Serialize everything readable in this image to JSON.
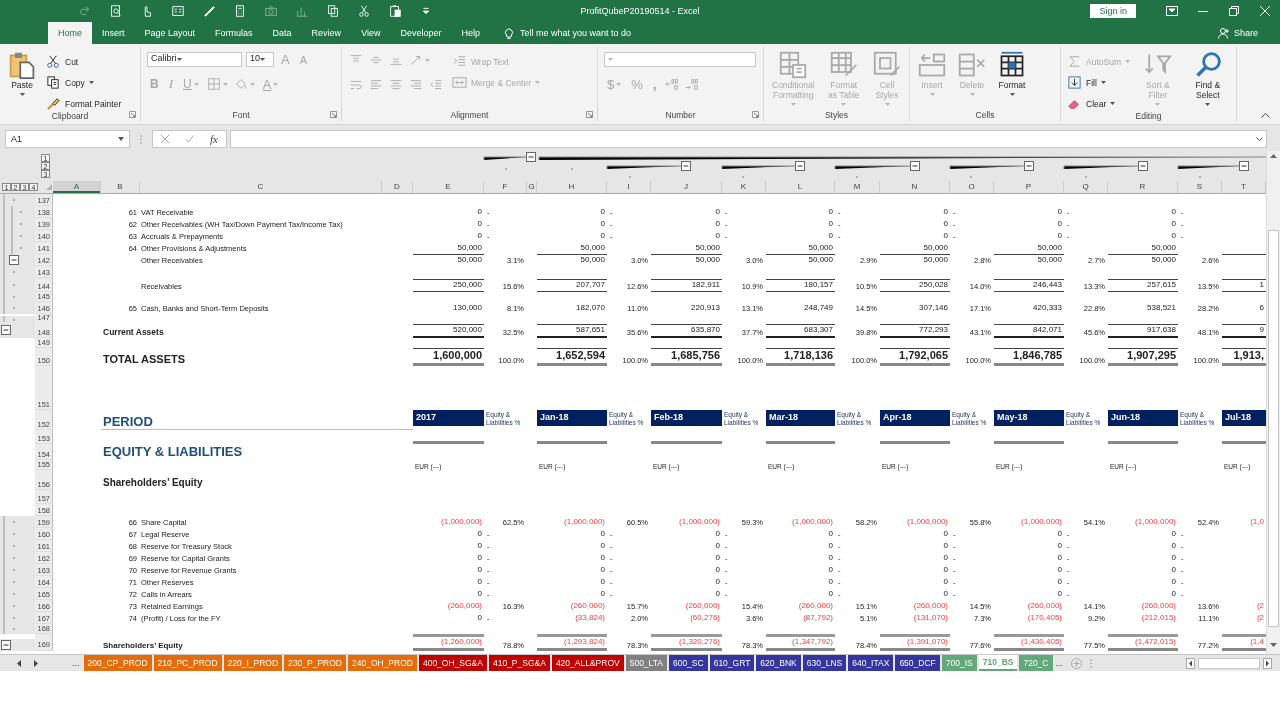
{
  "window": {
    "title": "ProfitQubeP20190514 - Excel",
    "sign_in": "Sign in",
    "share": "Share"
  },
  "quick_access": [
    {
      "disabled": true
    },
    {
      "disabled": false
    },
    {
      "disabled": false
    },
    {
      "disabled": false
    },
    {
      "disabled": false
    },
    {
      "disabled": false
    },
    {
      "disabled": true
    },
    {
      "disabled": true
    },
    {
      "disabled": false
    },
    {
      "disabled": false
    },
    {
      "disabled": false
    },
    {
      "disabled": false
    }
  ],
  "ribbon_tabs": [
    {
      "label": "Home",
      "selected": true
    },
    {
      "label": "Insert",
      "selected": false
    },
    {
      "label": "Page Layout",
      "selected": false
    },
    {
      "label": "Formulas",
      "selected": false
    },
    {
      "label": "Data",
      "selected": false
    },
    {
      "label": "Review",
      "selected": false
    },
    {
      "label": "View",
      "selected": false
    },
    {
      "label": "Developer",
      "selected": false
    },
    {
      "label": "Help",
      "selected": false
    }
  ],
  "tell_me": "Tell me what you want to do",
  "ribbon": {
    "groups": [
      {
        "label": "Clipboard",
        "launcher": true,
        "columns": [
          [
            [
              {
                "kind": "large",
                "label": "Paste",
                "dropdown": true,
                "disabled": false
              }
            ]
          ],
          [
            [
              {
                "kind": "small",
                "label": "Cut",
                "dropdown": false,
                "disabled": false
              }
            ],
            [
              {
                "kind": "small",
                "label": "Copy",
                "dropdown": true,
                "disabled": false
              }
            ],
            [
              {
                "kind": "small",
                "label": "Format Painter",
                "dropdown": false,
                "disabled": false
              }
            ]
          ]
        ]
      },
      {
        "label": "Font",
        "launcher": true,
        "columns": [
          [
            [
              {
                "kind": "field",
                "value": "Calibri",
                "dropdown": true,
                "disabled": false
              },
              {
                "kind": "field",
                "value": "10",
                "dropdown": true,
                "disabled": false
              },
              {
                "kind": "glyph",
                "label": "A",
                "dropdown": false,
                "disabled": true
              },
              {
                "kind": "glyph",
                "label": "A",
                "dropdown": false,
                "disabled": true
              }
            ],
            [
              {
                "kind": "glyph",
                "label": "B",
                "dropdown": false,
                "disabled": true
              },
              {
                "kind": "glyph",
                "label": "I",
                "dropdown": false,
                "disabled": true
              },
              {
                "kind": "glyph",
                "label": "U",
                "dropdown": true,
                "disabled": true
              },
              {
                "kind": "icon",
                "dropdown": true,
                "disabled": true
              },
              {
                "kind": "icon",
                "dropdown": true,
                "disabled": true
              },
              {
                "kind": "glyph",
                "label": "A",
                "dropdown": true,
                "disabled": true
              }
            ]
          ]
        ]
      },
      {
        "label": "Alignment",
        "launcher": true,
        "columns": [
          [
            [
              {
                "kind": "icon",
                "dropdown": false,
                "disabled": true
              },
              {
                "kind": "icon",
                "dropdown": false,
                "disabled": true
              },
              {
                "kind": "icon",
                "dropdown": false,
                "disabled": true
              },
              {
                "kind": "icon",
                "dropdown": true,
                "disabled": true
              }
            ],
            [
              {
                "kind": "icon",
                "dropdown": false,
                "disabled": true
              },
              {
                "kind": "icon",
                "dropdown": false,
                "disabled": true
              },
              {
                "kind": "icon",
                "dropdown": false,
                "disabled": true
              },
              {
                "kind": "icon",
                "dropdown": false,
                "disabled": true
              },
              {
                "kind": "icon",
                "dropdown": false,
                "disabled": true
              }
            ]
          ],
          [
            [
              {
                "kind": "small",
                "label": "Wrap Text",
                "dropdown": false,
                "disabled": true
              }
            ],
            [
              {
                "kind": "small",
                "label": "Merge & Center",
                "dropdown": true,
                "disabled": true
              }
            ]
          ]
        ]
      },
      {
        "label": "Number",
        "launcher": true,
        "columns": [
          [
            [
              {
                "kind": "field",
                "dropdown": true,
                "disabled": true
              }
            ],
            [
              {
                "kind": "glyph",
                "label": "$",
                "dropdown": true,
                "disabled": true
              },
              {
                "kind": "glyph",
                "label": "%",
                "dropdown": false,
                "disabled": true
              },
              {
                "kind": "glyph",
                "label": ",",
                "dropdown": false,
                "disabled": true
              },
              {
                "kind": "icon",
                "dropdown": false,
                "disabled": true
              },
              {
                "kind": "icon",
                "dropdown": false,
                "disabled": true
              }
            ]
          ]
        ]
      },
      {
        "label": "Styles",
        "columns": [
          [
            [
              {
                "kind": "large",
                "label": "Conditional Formatting",
                "dropdown": true,
                "disabled": true
              }
            ]
          ],
          [
            [
              {
                "kind": "large",
                "label": "Format as Table",
                "dropdown": true,
                "disabled": true
              }
            ]
          ],
          [
            [
              {
                "kind": "large",
                "label": "Cell Styles",
                "dropdown": true,
                "disabled": true
              }
            ]
          ]
        ]
      },
      {
        "label": "Cells",
        "columns": [
          [
            [
              {
                "kind": "large",
                "label": "Insert",
                "dropdown": true,
                "disabled": true
              }
            ]
          ],
          [
            [
              {
                "kind": "large",
                "label": "Delete",
                "dropdown": true,
                "disabled": true
              }
            ]
          ],
          [
            [
              {
                "kind": "large",
                "label": "Format",
                "dropdown": true,
                "disabled": false
              }
            ]
          ]
        ]
      },
      {
        "label": "Editing",
        "columns": [
          [
            [
              {
                "kind": "small",
                "label": "AutoSum",
                "dropdown": true,
                "disabled": true
              }
            ],
            [
              {
                "kind": "small",
                "label": "Fill",
                "dropdown": true,
                "disabled": false
              }
            ],
            [
              {
                "kind": "small",
                "label": "Clear",
                "dropdown": true,
                "disabled": false
              }
            ]
          ],
          [
            [
              {
                "kind": "large",
                "label": "Sort & Filter",
                "dropdown": true,
                "disabled": true
              }
            ]
          ],
          [
            [
              {
                "kind": "large",
                "label": "Find & Select",
                "dropdown": true,
                "disabled": false
              }
            ]
          ]
        ]
      }
    ]
  },
  "formula_bar": {
    "name_box": "A1",
    "function_label": "fx"
  },
  "outline_levels": {
    "columns": [
      "1",
      "2",
      "3"
    ],
    "rows": [
      "1",
      "2",
      "3",
      "4"
    ]
  },
  "columns": [
    {
      "label": "A",
      "selected": true
    },
    {
      "label": "B",
      "selected": false
    },
    {
      "label": "C",
      "selected": false
    },
    {
      "label": "D",
      "selected": false
    },
    {
      "label": "E",
      "selected": false
    },
    {
      "label": "F",
      "selected": false
    },
    {
      "label": "G",
      "selected": false
    },
    {
      "label": "H",
      "selected": false
    },
    {
      "label": "I",
      "selected": false
    },
    {
      "label": "J",
      "selected": false
    },
    {
      "label": "K",
      "selected": false
    },
    {
      "label": "L",
      "selected": false
    },
    {
      "label": "M",
      "selected": false
    },
    {
      "label": "N",
      "selected": false
    },
    {
      "label": "O",
      "selected": false
    },
    {
      "label": "P",
      "selected": false
    },
    {
      "label": "Q",
      "selected": false
    },
    {
      "label": "R",
      "selected": false
    },
    {
      "label": "S",
      "selected": false
    },
    {
      "label": "T",
      "selected": false
    }
  ],
  "rows": [
    {
      "number": "137",
      "kind": "blank",
      "outline": {
        "kind": "dot"
      }
    },
    {
      "number": "138",
      "kind": "item",
      "outline": {
        "kind": "inner-dot"
      },
      "code": "61",
      "label": "VAT Receivable",
      "values": [
        {
          "amount": "0",
          "pct": "-",
          "kind": "dash"
        },
        {
          "amount": "0",
          "pct": "-",
          "kind": "dash"
        },
        {
          "amount": "0",
          "pct": "-",
          "kind": "dash"
        },
        {
          "amount": "0",
          "pct": "-",
          "kind": "dash"
        },
        {
          "amount": "0",
          "pct": "-",
          "kind": "dash"
        },
        {
          "amount": "0",
          "pct": "-",
          "kind": "dash"
        },
        {
          "amount": "0",
          "pct": "-",
          "kind": "dash"
        }
      ]
    },
    {
      "number": "139",
      "kind": "item",
      "outline": {
        "kind": "inner-dot"
      },
      "code": "62",
      "label": "Other Receivables (WH Tax/Down Payment Tax/Income Tax)",
      "values": [
        {
          "amount": "0",
          "pct": "-",
          "kind": "dash"
        },
        {
          "amount": "0",
          "pct": "-",
          "kind": "dash"
        },
        {
          "amount": "0",
          "pct": "-",
          "kind": "dash"
        },
        {
          "amount": "0",
          "pct": "-",
          "kind": "dash"
        },
        {
          "amount": "0",
          "pct": "-",
          "kind": "dash"
        },
        {
          "amount": "0",
          "pct": "-",
          "kind": "dash"
        },
        {
          "amount": "0",
          "pct": "-",
          "kind": "dash"
        }
      ]
    },
    {
      "number": "140",
      "kind": "item",
      "outline": {
        "kind": "inner-dot"
      },
      "code": "63",
      "label": "Accruals & Prepayments",
      "values": [
        {
          "amount": "0",
          "pct": "-",
          "kind": "dash"
        },
        {
          "amount": "0",
          "pct": "-",
          "kind": "dash"
        },
        {
          "amount": "0",
          "pct": "-",
          "kind": "dash"
        },
        {
          "amount": "0",
          "pct": "-",
          "kind": "dash"
        },
        {
          "amount": "0",
          "pct": "-",
          "kind": "dash"
        },
        {
          "amount": "0",
          "pct": "-",
          "kind": "dash"
        },
        {
          "amount": "0",
          "pct": "-",
          "kind": "dash"
        }
      ]
    },
    {
      "number": "141",
      "kind": "item",
      "outline": {
        "kind": "inner-dot"
      },
      "code": "64",
      "label": "Other Provisions & Adjustments",
      "values": [
        {
          "amount": "50,000",
          "kind": "number"
        },
        {
          "amount": "50,000",
          "kind": "number"
        },
        {
          "amount": "50,000",
          "kind": "number"
        },
        {
          "amount": "50,000",
          "kind": "number"
        },
        {
          "amount": "50,000",
          "kind": "number"
        },
        {
          "amount": "50,000",
          "kind": "number"
        },
        {
          "amount": "50,000",
          "kind": "number"
        }
      ]
    },
    {
      "number": "142",
      "kind": "subtotal",
      "outline": {
        "kind": "collapse"
      },
      "label": "Other Receivables",
      "values": [
        {
          "amount": "50,000",
          "pct": "3.1%",
          "kind": "number"
        },
        {
          "amount": "50,000",
          "pct": "3.0%",
          "kind": "number"
        },
        {
          "amount": "50,000",
          "pct": "3.0%",
          "kind": "number"
        },
        {
          "amount": "50,000",
          "pct": "2.9%",
          "kind": "number"
        },
        {
          "amount": "50,000",
          "pct": "2.8%",
          "kind": "number"
        },
        {
          "amount": "50,000",
          "pct": "2.7%",
          "kind": "number"
        },
        {
          "amount": "50,000",
          "pct": "2.6%",
          "kind": "number"
        }
      ]
    },
    {
      "number": "143",
      "kind": "blank",
      "outline": {
        "kind": "dot"
      }
    },
    {
      "number": "144",
      "kind": "total",
      "outline": {
        "kind": "dot"
      },
      "label": "Receivables",
      "values": [
        {
          "amount": "250,000",
          "pct": "15.6%",
          "kind": "number"
        },
        {
          "amount": "207,707",
          "pct": "12.6%",
          "kind": "number"
        },
        {
          "amount": "182,911",
          "pct": "10.9%",
          "kind": "number"
        },
        {
          "amount": "180,157",
          "pct": "10.5%",
          "kind": "number"
        },
        {
          "amount": "250,028",
          "pct": "14.0%",
          "kind": "number"
        },
        {
          "amount": "246,443",
          "pct": "13.3%",
          "kind": "number"
        },
        {
          "amount": "257,615",
          "pct": "13.5%",
          "kind": "number"
        },
        {
          "amount": "1",
          "kind": "number"
        }
      ]
    },
    {
      "number": "145",
      "kind": "blank",
      "outline": {
        "kind": "dot"
      }
    },
    {
      "number": "146",
      "kind": "item",
      "outline": {
        "kind": "dot"
      },
      "code": "65",
      "label": "Cash, Banks and Short-Term Deposits",
      "values": [
        {
          "amount": "130,000",
          "pct": "8.1%",
          "kind": "number"
        },
        {
          "amount": "182,070",
          "pct": "11.0%",
          "kind": "number"
        },
        {
          "amount": "220,913",
          "pct": "13.1%",
          "kind": "number"
        },
        {
          "amount": "248,749",
          "pct": "14.5%",
          "kind": "number"
        },
        {
          "amount": "307,146",
          "pct": "17.1%",
          "kind": "number"
        },
        {
          "amount": "420,333",
          "pct": "22.8%",
          "kind": "number"
        },
        {
          "amount": "538,521",
          "pct": "28.2%",
          "kind": "number"
        },
        {
          "amount": "6",
          "kind": "number"
        }
      ]
    },
    {
      "number": "147",
      "kind": "blank",
      "outline": {
        "kind": "dot"
      }
    },
    {
      "number": "148",
      "kind": "section-total",
      "outline": {
        "kind": "outer-collapse"
      },
      "label": "Current Assets",
      "values": [
        {
          "amount": "520,000",
          "pct": "32.5%",
          "kind": "number"
        },
        {
          "amount": "587,651",
          "pct": "35.6%",
          "kind": "number"
        },
        {
          "amount": "635,870",
          "pct": "37.7%",
          "kind": "number"
        },
        {
          "amount": "683,307",
          "pct": "39.8%",
          "kind": "number"
        },
        {
          "amount": "772,293",
          "pct": "43.1%",
          "kind": "number"
        },
        {
          "amount": "842,071",
          "pct": "45.6%",
          "kind": "number"
        },
        {
          "amount": "917,638",
          "pct": "48.1%",
          "kind": "number"
        },
        {
          "amount": "9",
          "kind": "number"
        }
      ]
    },
    {
      "number": "149",
      "kind": "blank"
    },
    {
      "number": "150",
      "kind": "grand-total",
      "label": "TOTAL ASSETS",
      "values": [
        {
          "amount": "1,600,000",
          "pct": "100.0%",
          "kind": "number"
        },
        {
          "amount": "1,652,594",
          "pct": "100.0%",
          "kind": "number"
        },
        {
          "amount": "1,685,756",
          "pct": "100.0%",
          "kind": "number"
        },
        {
          "amount": "1,718,136",
          "pct": "100.0%",
          "kind": "number"
        },
        {
          "amount": "1,792,065",
          "pct": "100.0%",
          "kind": "number"
        },
        {
          "amount": "1,846,785",
          "pct": "100.0%",
          "kind": "number"
        },
        {
          "amount": "1,907,295",
          "pct": "100.0%",
          "kind": "number"
        },
        {
          "amount": "1,913,",
          "kind": "number"
        }
      ]
    },
    {
      "number": "151",
      "kind": "blank"
    },
    {
      "number": "152",
      "kind": "period-header",
      "label": "PERIOD",
      "periods": [
        {
          "label": "2017",
          "note": "Equity & Liabilities %"
        },
        {
          "label": "Jan-18",
          "note": "Equity & Liabilities %"
        },
        {
          "label": "Feb-18",
          "note": "Equity & Liabilities %"
        },
        {
          "label": "Mar-18",
          "note": "Equity & Liabilities %"
        },
        {
          "label": "Apr-18",
          "note": "Equity & Liabilities %"
        },
        {
          "label": "May-18",
          "note": "Equity & Liabilities %"
        },
        {
          "label": "Jun-18",
          "note": "Equity & Liabilities %"
        },
        {
          "label": "Jul-18"
        }
      ]
    },
    {
      "number": "153",
      "kind": "rule"
    },
    {
      "number": "154",
      "kind": "heading",
      "label": "EQUITY & LIABILITIES"
    },
    {
      "number": "155",
      "kind": "units",
      "units": [
        "EUR (---)",
        "EUR (---)",
        "EUR (---)",
        "EUR (---)",
        "EUR (---)",
        "EUR (---)",
        "EUR (---)",
        "EUR (---)"
      ]
    },
    {
      "number": "156",
      "kind": "subheading",
      "label": "Shareholders’ Equity"
    },
    {
      "number": "157",
      "kind": "blank"
    },
    {
      "number": "158",
      "kind": "blank"
    },
    {
      "number": "159",
      "kind": "item",
      "outline": {
        "kind": "dot"
      },
      "code": "66",
      "label": "Share Capital",
      "values": [
        {
          "amount": "(1,000,000)",
          "pct": "62.5%",
          "kind": "negative"
        },
        {
          "amount": "(1,000,000)",
          "pct": "60.5%",
          "kind": "negative"
        },
        {
          "amount": "(1,000,000)",
          "pct": "59.3%",
          "kind": "negative"
        },
        {
          "amount": "(1,000,000)",
          "pct": "58.2%",
          "kind": "negative"
        },
        {
          "amount": "(1,000,000)",
          "pct": "55.8%",
          "kind": "negative"
        },
        {
          "amount": "(1,000,000)",
          "pct": "54.1%",
          "kind": "negative"
        },
        {
          "amount": "(1,000,000)",
          "pct": "52.4%",
          "kind": "negative"
        },
        {
          "amount": "(1,0",
          "kind": "negative"
        }
      ]
    },
    {
      "number": "160",
      "kind": "item",
      "outline": {
        "kind": "dot"
      },
      "code": "67",
      "label": "Legal Reserve",
      "values": [
        {
          "amount": "0",
          "pct": "-",
          "kind": "dash"
        },
        {
          "amount": "0",
          "pct": "-",
          "kind": "dash"
        },
        {
          "amount": "0",
          "pct": "-",
          "kind": "dash"
        },
        {
          "amount": "0",
          "pct": "-",
          "kind": "dash"
        },
        {
          "amount": "0",
          "pct": "-",
          "kind": "dash"
        },
        {
          "amount": "0",
          "pct": "-",
          "kind": "dash"
        },
        {
          "amount": "0",
          "pct": "-",
          "kind": "dash"
        }
      ]
    },
    {
      "number": "161",
      "kind": "item",
      "outline": {
        "kind": "dot"
      },
      "code": "68",
      "label": "Reserve for Treasury Stock",
      "values": [
        {
          "amount": "0",
          "pct": "-",
          "kind": "dash"
        },
        {
          "amount": "0",
          "pct": "-",
          "kind": "dash"
        },
        {
          "amount": "0",
          "pct": "-",
          "kind": "dash"
        },
        {
          "amount": "0",
          "pct": "-",
          "kind": "dash"
        },
        {
          "amount": "0",
          "pct": "-",
          "kind": "dash"
        },
        {
          "amount": "0",
          "pct": "-",
          "kind": "dash"
        },
        {
          "amount": "0",
          "pct": "-",
          "kind": "dash"
        }
      ]
    },
    {
      "number": "162",
      "kind": "item",
      "outline": {
        "kind": "dot"
      },
      "code": "69",
      "label": "Reserve for Capital Grants",
      "values": [
        {
          "amount": "0",
          "pct": "-",
          "kind": "dash"
        },
        {
          "amount": "0",
          "pct": "-",
          "kind": "dash"
        },
        {
          "amount": "0",
          "pct": "-",
          "kind": "dash"
        },
        {
          "amount": "0",
          "pct": "-",
          "kind": "dash"
        },
        {
          "amount": "0",
          "pct": "-",
          "kind": "dash"
        },
        {
          "amount": "0",
          "pct": "-",
          "kind": "dash"
        },
        {
          "amount": "0",
          "pct": "-",
          "kind": "dash"
        }
      ]
    },
    {
      "number": "163",
      "kind": "item",
      "outline": {
        "kind": "dot"
      },
      "code": "70",
      "label": "Reserve for Revenue Grants",
      "values": [
        {
          "amount": "0",
          "pct": "-",
          "kind": "dash"
        },
        {
          "amount": "0",
          "pct": "-",
          "kind": "dash"
        },
        {
          "amount": "0",
          "pct": "-",
          "kind": "dash"
        },
        {
          "amount": "0",
          "pct": "-",
          "kind": "dash"
        },
        {
          "amount": "0",
          "pct": "-",
          "kind": "dash"
        },
        {
          "amount": "0",
          "pct": "-",
          "kind": "dash"
        },
        {
          "amount": "0",
          "pct": "-",
          "kind": "dash"
        }
      ]
    },
    {
      "number": "164",
      "kind": "item",
      "outline": {
        "kind": "dot"
      },
      "code": "71",
      "label": "Other Reserves",
      "values": [
        {
          "amount": "0",
          "pct": "-",
          "kind": "dash"
        },
        {
          "amount": "0",
          "pct": "-",
          "kind": "dash"
        },
        {
          "amount": "0",
          "pct": "-",
          "kind": "dash"
        },
        {
          "amount": "0",
          "pct": "-",
          "kind": "dash"
        },
        {
          "amount": "0",
          "pct": "-",
          "kind": "dash"
        },
        {
          "amount": "0",
          "pct": "-",
          "kind": "dash"
        },
        {
          "amount": "0",
          "pct": "-",
          "kind": "dash"
        }
      ]
    },
    {
      "number": "165",
      "kind": "item",
      "outline": {
        "kind": "dot"
      },
      "code": "72",
      "label": "Calls in Arrears",
      "values": [
        {
          "amount": "0",
          "pct": "-",
          "kind": "dash"
        },
        {
          "amount": "0",
          "pct": "-",
          "kind": "dash"
        },
        {
          "amount": "0",
          "pct": "-",
          "kind": "dash"
        },
        {
          "amount": "0",
          "pct": "-",
          "kind": "dash"
        },
        {
          "amount": "0",
          "pct": "-",
          "kind": "dash"
        },
        {
          "amount": "0",
          "pct": "-",
          "kind": "dash"
        },
        {
          "amount": "0",
          "pct": "-",
          "kind": "dash"
        }
      ]
    },
    {
      "number": "166",
      "kind": "item",
      "outline": {
        "kind": "dot"
      },
      "code": "73",
      "label": "Retained Earnings",
      "values": [
        {
          "amount": "(260,000)",
          "pct": "16.3%",
          "kind": "negative"
        },
        {
          "amount": "(260,000)",
          "pct": "15.7%",
          "kind": "negative"
        },
        {
          "amount": "(260,000)",
          "pct": "15.4%",
          "kind": "negative"
        },
        {
          "amount": "(260,000)",
          "pct": "15.1%",
          "kind": "negative"
        },
        {
          "amount": "(260,000)",
          "pct": "14.5%",
          "kind": "negative"
        },
        {
          "amount": "(260,000)",
          "pct": "14.1%",
          "kind": "negative"
        },
        {
          "amount": "(260,000)",
          "pct": "13.6%",
          "kind": "negative"
        },
        {
          "amount": "(2",
          "kind": "negative"
        }
      ]
    },
    {
      "number": "167",
      "kind": "item",
      "outline": {
        "kind": "dot"
      },
      "code": "74",
      "label": "(Profit) / Loss for the FY",
      "values": [
        {
          "amount": "0",
          "pct": "-",
          "kind": "dash"
        },
        {
          "amount": "(33,824)",
          "pct": "2.0%",
          "kind": "negative"
        },
        {
          "amount": "(60,276)",
          "pct": "3.6%",
          "kind": "negative"
        },
        {
          "amount": "(87,792)",
          "pct": "5.1%",
          "kind": "negative"
        },
        {
          "amount": "(131,070)",
          "pct": "7.3%",
          "kind": "negative"
        },
        {
          "amount": "(170,405)",
          "pct": "9.2%",
          "kind": "negative"
        },
        {
          "amount": "(212,015)",
          "pct": "11.1%",
          "kind": "negative"
        },
        {
          "amount": "(2",
          "kind": "negative"
        }
      ]
    },
    {
      "number": "168",
      "kind": "blank",
      "outline": {
        "kind": "dot"
      }
    },
    {
      "number": "169",
      "kind": "equity-total",
      "outline": {
        "kind": "outer-collapse"
      },
      "label": "Shareholders’ Equity",
      "values": [
        {
          "amount": "(1,260,000)",
          "pct": "78.8%",
          "kind": "negative"
        },
        {
          "amount": "(1,293,824)",
          "pct": "78.3%",
          "kind": "negative"
        },
        {
          "amount": "(1,320,276)",
          "pct": "78.3%",
          "kind": "negative"
        },
        {
          "amount": "(1,347,792)",
          "pct": "78.4%",
          "kind": "negative"
        },
        {
          "amount": "(1,391,070)",
          "pct": "77.6%",
          "kind": "negative"
        },
        {
          "amount": "(1,430,405)",
          "pct": "77.5%",
          "kind": "negative"
        },
        {
          "amount": "(1,472,015)",
          "pct": "77.2%",
          "kind": "negative"
        },
        {
          "amount": "(1,4",
          "kind": "negative"
        }
      ]
    }
  ],
  "tab_overflow": [
    "...",
    "..."
  ],
  "sheet_tabs": [
    {
      "label": "200_CP_PROD",
      "color": "#e46c0a",
      "selected": false
    },
    {
      "label": "210_PC_PROD",
      "color": "#e46c0a",
      "selected": false
    },
    {
      "label": "220_I_PROD",
      "color": "#e46c0a",
      "selected": false
    },
    {
      "label": "230_P_PROD",
      "color": "#e46c0a",
      "selected": false
    },
    {
      "label": "240_OH_PROD",
      "color": "#e46c0a",
      "selected": false
    },
    {
      "label": "400_OH_SG&A",
      "color": "#c00000",
      "selected": false
    },
    {
      "label": "410_P_SG&A",
      "color": "#c00000",
      "selected": false
    },
    {
      "label": "420_ALL&PROV",
      "color": "#c00000",
      "selected": false
    },
    {
      "label": "500_LTA",
      "color": "#808080",
      "selected": false
    },
    {
      "label": "600_SC",
      "color": "#3535a0",
      "selected": false
    },
    {
      "label": "610_GRT",
      "color": "#3535a0",
      "selected": false
    },
    {
      "label": "620_BNK",
      "color": "#3535a0",
      "selected": false
    },
    {
      "label": "630_LNS",
      "color": "#3535a0",
      "selected": false
    },
    {
      "label": "640_ITAX",
      "color": "#3535a0",
      "selected": false
    },
    {
      "label": "650_DCF",
      "color": "#3535a0",
      "selected": false
    },
    {
      "label": "700_IS",
      "color": "#62a878",
      "selected": false
    },
    {
      "label": "710_BS",
      "color": "#62a878",
      "selected": true
    },
    {
      "label": "720_C",
      "color": "#62a878",
      "selected": false
    }
  ]
}
